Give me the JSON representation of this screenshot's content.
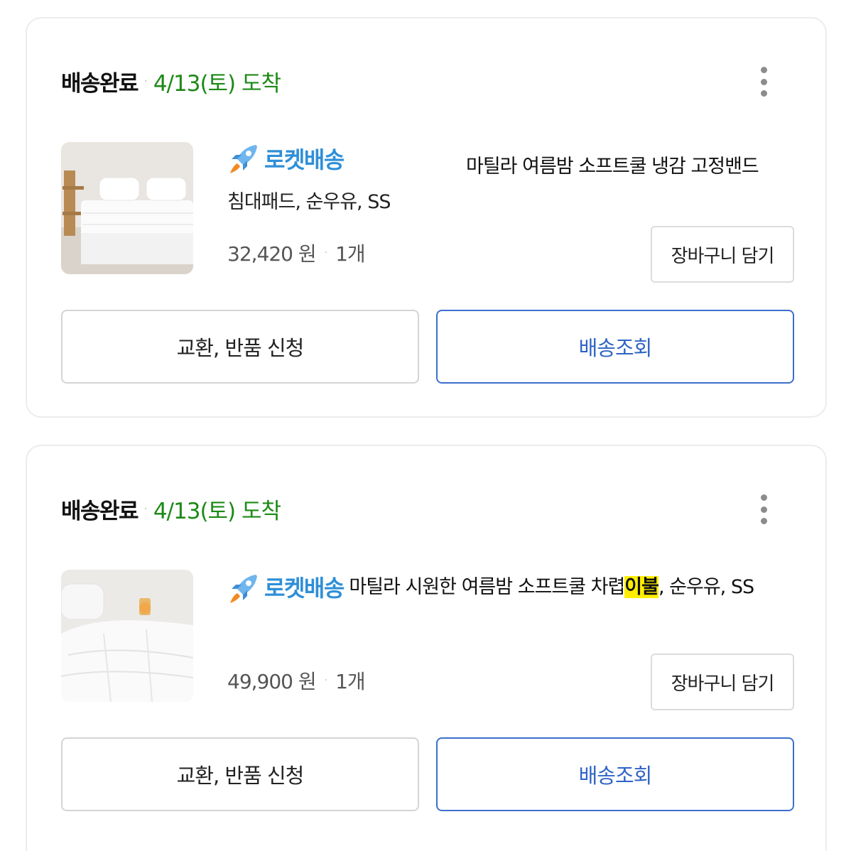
{
  "orders": [
    {
      "status": "배송완료",
      "separator": "·",
      "arrival": "4/13(토) 도착",
      "badge": "로켓배송",
      "title": "마틸라 여름밤 소프트쿨 냉감 고정밴드",
      "option": "침대패드, 순우유, SS",
      "price": "32,420 원",
      "qty_sep": "·",
      "qty": "1개",
      "cart_label": "장바구니 담기",
      "return_label": "교환, 반품 신청",
      "track_label": "배송조회"
    },
    {
      "status": "배송완료",
      "separator": "·",
      "arrival": "4/13(토) 도착",
      "badge": "로켓배송",
      "title_prefix": "마틸라 시원한 여름밤 소프트쿨 차렵",
      "title_highlight": "이불",
      "title_suffix": ", 순우유, SS",
      "price": "49,900 원",
      "qty_sep": "·",
      "qty": "1개",
      "cart_label": "장바구니 담기",
      "return_label": "교환, 반품 신청",
      "track_label": "배송조회"
    }
  ],
  "colors": {
    "arrival_green": "#1d8a17",
    "rocket_blue": "#2f8fd8",
    "track_blue": "#3c6fcf",
    "highlight_yellow": "#ffee00"
  },
  "icons": {
    "rocket": "rocket-icon",
    "more": "more-vertical-icon"
  }
}
